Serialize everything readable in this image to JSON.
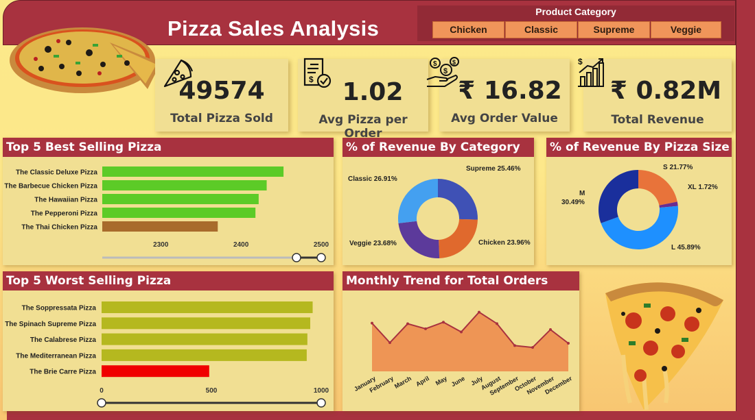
{
  "header": {
    "title": "Pizza Sales Analysis"
  },
  "filter": {
    "title": "Product Category",
    "options": [
      "Chicken",
      "Classic",
      "Supreme",
      "Veggie"
    ]
  },
  "kpis": [
    {
      "value": "49574",
      "label": "Total Pizza Sold",
      "icon": "pizza-slice-icon"
    },
    {
      "value": "1.02",
      "label": "Avg Pizza per Order",
      "icon": "invoice-check-icon"
    },
    {
      "value": "₹ 16.82",
      "label": "Avg Order Value",
      "icon": "money-hand-icon"
    },
    {
      "value": "₹ 0.82M",
      "label": "Total Revenue",
      "icon": "growth-chart-icon"
    }
  ],
  "colors": {
    "maroon": "#a8323f",
    "panel": "#f1df93",
    "bestBar": "#5ccb27",
    "bestBarLow": "#a86b2c",
    "worstBar": "#b5b81f",
    "worstBarLow": "#f00000",
    "area": "#ee9555",
    "line": "#a8323f"
  },
  "chart_data": [
    {
      "type": "bar",
      "title": "Top 5 Best Selling Pizza",
      "orientation": "horizontal",
      "categories": [
        "The Classic Deluxe Pizza",
        "The Barbecue Chicken Pizza",
        "The Hawaiian Pizza",
        "The Pepperoni Pizza",
        "The Thai Chicken Pizza"
      ],
      "values": [
        2453,
        2432,
        2422,
        2418,
        2371
      ],
      "xlim": [
        2227,
        2500
      ],
      "xticks": [
        "2300",
        "2400",
        "2500"
      ]
    },
    {
      "type": "pie",
      "title": "% of Revenue By Category",
      "categories": [
        "Supreme",
        "Chicken",
        "Veggie",
        "Classic"
      ],
      "values": [
        25.46,
        23.96,
        23.68,
        26.91
      ],
      "labels": [
        "Supreme 25.46%",
        "Chicken 23.96%",
        "Veggie 23.68%",
        "Classic 26.91%"
      ],
      "colors": [
        "#3f51b5",
        "#e0692d",
        "#5c3a9b",
        "#44a0f0"
      ]
    },
    {
      "type": "pie",
      "title": "% of Revenue By Pizza Size",
      "categories": [
        "S",
        "XL",
        "L",
        "M"
      ],
      "values": [
        21.77,
        1.72,
        45.89,
        30.49
      ],
      "labels": [
        "S 21.77%",
        "XL 1.72%",
        "L 45.89%",
        "M",
        "30.49%"
      ],
      "colors": [
        "#e8733a",
        "#6a2c91",
        "#1e90ff",
        "#1a2f9c"
      ]
    },
    {
      "type": "bar",
      "title": "Top 5 Worst Selling Pizza",
      "orientation": "horizontal",
      "categories": [
        "The Soppressata Pizza",
        "The Spinach Supreme Pizza",
        "The Calabrese Pizza",
        "The Mediterranean Pizza",
        "The Brie Carre Pizza"
      ],
      "values": [
        961,
        950,
        937,
        934,
        490
      ],
      "xlim": [
        0,
        1000
      ],
      "xticks": [
        "0",
        "500",
        "1000"
      ]
    },
    {
      "type": "area",
      "title": "Monthly Trend for Total Orders",
      "categories": [
        "January",
        "February",
        "March",
        "April",
        "May",
        "June",
        "July",
        "August",
        "September",
        "October",
        "November",
        "December"
      ],
      "values": [
        1845,
        1685,
        1840,
        1799,
        1853,
        1773,
        1935,
        1841,
        1661,
        1646,
        1792,
        1680
      ],
      "ylim": [
        1450,
        2000
      ]
    }
  ]
}
